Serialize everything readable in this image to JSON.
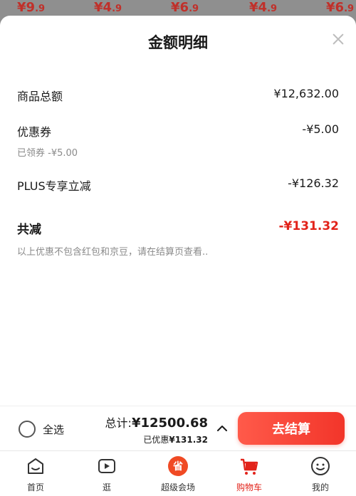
{
  "background_prices": [
    {
      "main": "¥9",
      "dec": ".9"
    },
    {
      "main": "¥4",
      "dec": ".9"
    },
    {
      "main": "¥6",
      "dec": ".9"
    },
    {
      "main": "¥4",
      "dec": ".9"
    },
    {
      "main": "¥6",
      "dec": ".9"
    }
  ],
  "sheet": {
    "title": "金额明细",
    "rows": {
      "goods_total": {
        "label": "商品总额",
        "value": "¥12,632.00"
      },
      "coupon": {
        "label": "优惠券",
        "value": "-¥5.00",
        "sub": "已领券 -¥5.00"
      },
      "plus": {
        "label": "PLUS专享立减",
        "value": "-¥126.32"
      },
      "total_reduction": {
        "label": "共减",
        "value": "-¥131.32"
      }
    },
    "note": "以上优惠不包含红包和京豆，请在结算页查看.."
  },
  "bottom_bar": {
    "select_all": "全选",
    "total_label": "总计:",
    "total_amount": "¥12500.68",
    "discount_label": "已优惠",
    "discount_amount": "¥131.32",
    "checkout": "去结算"
  },
  "tabs": [
    {
      "label": "首页",
      "icon": "home-icon"
    },
    {
      "label": "逛",
      "icon": "video-play-icon"
    },
    {
      "label": "超级会场",
      "icon": "super-venue-icon"
    },
    {
      "label": "购物车",
      "icon": "cart-icon",
      "active": true
    },
    {
      "label": "我的",
      "icon": "smiley-icon"
    }
  ],
  "colors": {
    "accent": "#e2231a",
    "checkout_gradient_start": "#ff5a4a",
    "checkout_gradient_end": "#f2352a"
  }
}
